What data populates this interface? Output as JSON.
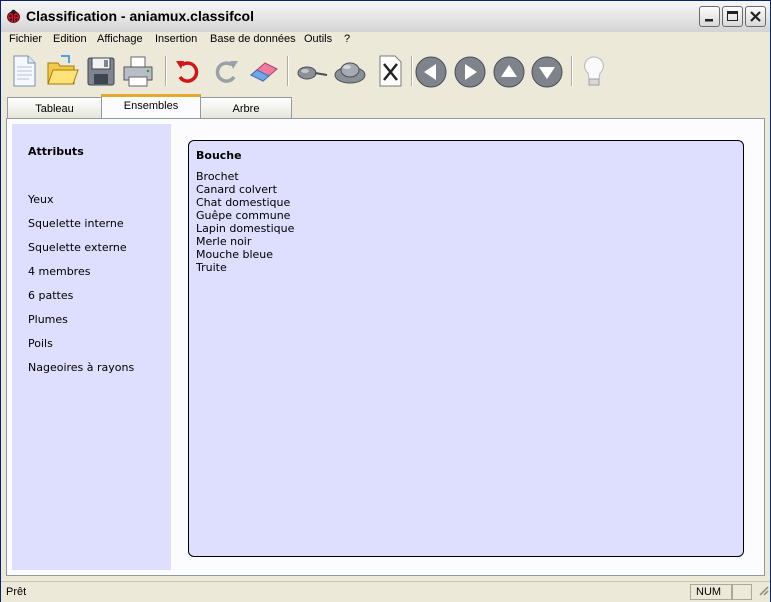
{
  "window": {
    "title": "Classification - aniamux.classifcol",
    "icon": "ladybug-icon"
  },
  "menu": [
    "Fichier",
    "Edition",
    "Affichage",
    "Insertion",
    "Base de données",
    "Outils",
    "?"
  ],
  "toolbar": {
    "icons": [
      "new-document-icon",
      "open-folder-icon",
      "save-disk-icon",
      "print-icon",
      "undo-icon",
      "redo-icon",
      "eraser-icon",
      "pin-icon",
      "hat-icon",
      "delete-icon",
      "arrow-left-icon",
      "arrow-right-icon",
      "arrow-up-icon",
      "arrow-down-icon",
      "lightbulb-icon"
    ]
  },
  "tabs": [
    {
      "label": "Tableau",
      "active": false
    },
    {
      "label": "Ensembles",
      "active": true
    },
    {
      "label": "Arbre",
      "active": false
    }
  ],
  "sidebar": {
    "title": "Attributs",
    "items": [
      "Yeux",
      "Squelette interne",
      "Squelette externe",
      "4 membres",
      "6 pattes",
      "Plumes",
      "Poils",
      "Nageoires à rayons"
    ]
  },
  "set": {
    "title": "Bouche",
    "members": [
      "Brochet",
      "Canard colvert",
      "Chat domestique",
      "Guêpe commune",
      "Lapin domestique",
      "Merle noir",
      "Mouche bleue",
      "Truite"
    ]
  },
  "status": {
    "text": "Prêt",
    "num": "NUM"
  },
  "colors": {
    "panel_bg": "#dedeff",
    "active_tab_accent": "#e8a82c"
  }
}
